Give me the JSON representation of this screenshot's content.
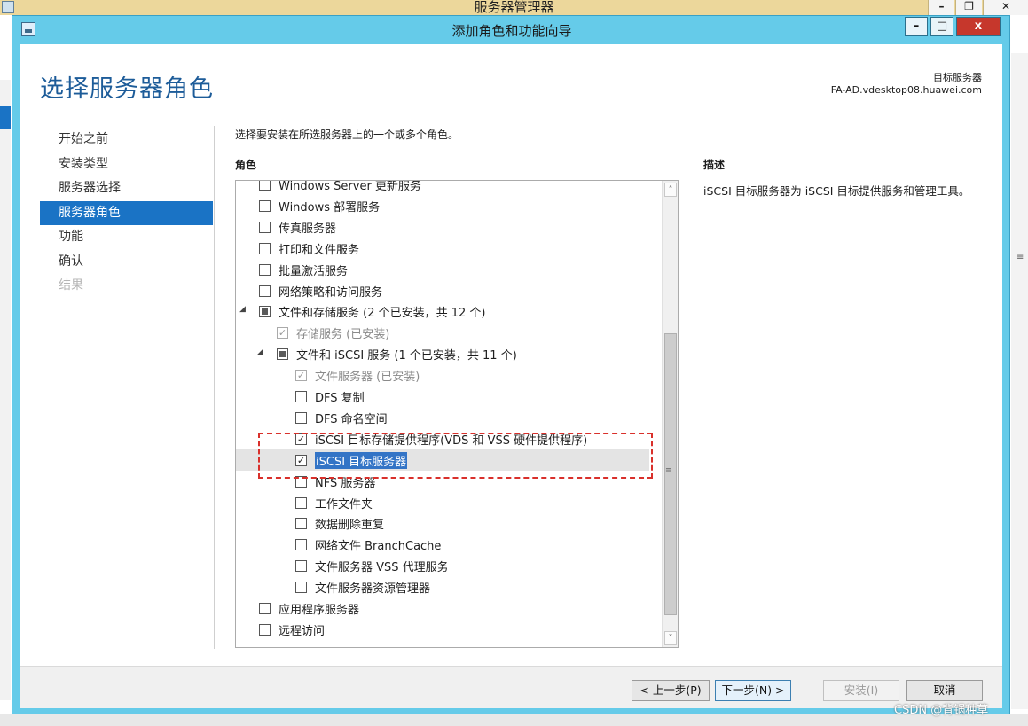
{
  "background_window": {
    "title": "服务器管理器",
    "buttons": [
      "–",
      "❐",
      "✕"
    ]
  },
  "wizard": {
    "title": "添加角色和功能向导",
    "controls": {
      "minimize": "–",
      "maximize": "□",
      "close": "x"
    },
    "heading": "选择服务器角色",
    "target_label": "目标服务器",
    "target_server": "FA-AD.vdesktop08.huawei.com"
  },
  "nav": {
    "items": [
      {
        "label": "开始之前",
        "state": "normal"
      },
      {
        "label": "安装类型",
        "state": "normal"
      },
      {
        "label": "服务器选择",
        "state": "normal"
      },
      {
        "label": "服务器角色",
        "state": "active"
      },
      {
        "label": "功能",
        "state": "normal"
      },
      {
        "label": "确认",
        "state": "normal"
      },
      {
        "label": "结果",
        "state": "disabled"
      }
    ]
  },
  "content": {
    "instruction": "选择要安装在所选服务器上的一个或多个角色。",
    "roles_label": "角色",
    "description_label": "描述",
    "description_text": "iSCSI 目标服务器为 iSCSI 目标提供服务和管理工具。"
  },
  "roles": [
    {
      "label": "Windows Server 更新服务",
      "level": 0,
      "check": "empty",
      "expander": "",
      "grey": false,
      "selected": false
    },
    {
      "label": "Windows 部署服务",
      "level": 0,
      "check": "empty",
      "expander": "",
      "grey": false,
      "selected": false
    },
    {
      "label": "传真服务器",
      "level": 0,
      "check": "empty",
      "expander": "",
      "grey": false,
      "selected": false
    },
    {
      "label": "打印和文件服务",
      "level": 0,
      "check": "empty",
      "expander": "",
      "grey": false,
      "selected": false
    },
    {
      "label": "批量激活服务",
      "level": 0,
      "check": "empty",
      "expander": "",
      "grey": false,
      "selected": false
    },
    {
      "label": "网络策略和访问服务",
      "level": 0,
      "check": "empty",
      "expander": "",
      "grey": false,
      "selected": false
    },
    {
      "label": "文件和存储服务 (2 个已安装，共 12 个)",
      "level": 0,
      "check": "partial",
      "expander": "◢",
      "grey": false,
      "selected": false
    },
    {
      "label": "存储服务 (已安装)",
      "level": 1,
      "check": "checked-disabled",
      "expander": "",
      "grey": true,
      "selected": false
    },
    {
      "label": "文件和 iSCSI 服务 (1 个已安装，共 11 个)",
      "level": 1,
      "check": "partial",
      "expander": "◢",
      "grey": false,
      "selected": false
    },
    {
      "label": "文件服务器 (已安装)",
      "level": 2,
      "check": "checked-disabled",
      "expander": "",
      "grey": true,
      "selected": false
    },
    {
      "label": "DFS 复制",
      "level": 2,
      "check": "empty",
      "expander": "",
      "grey": false,
      "selected": false
    },
    {
      "label": "DFS 命名空间",
      "level": 2,
      "check": "empty",
      "expander": "",
      "grey": false,
      "selected": false
    },
    {
      "label": "iSCSI 目标存储提供程序(VDS 和 VSS 硬件提供程序)",
      "level": 2,
      "check": "checked",
      "expander": "",
      "grey": false,
      "selected": false
    },
    {
      "label": "iSCSI 目标服务器",
      "level": 2,
      "check": "checked",
      "expander": "",
      "grey": false,
      "selected": true
    },
    {
      "label": "NFS 服务器",
      "level": 2,
      "check": "empty",
      "expander": "",
      "grey": false,
      "selected": false
    },
    {
      "label": "工作文件夹",
      "level": 2,
      "check": "empty",
      "expander": "",
      "grey": false,
      "selected": false
    },
    {
      "label": "数据删除重复",
      "level": 2,
      "check": "empty",
      "expander": "",
      "grey": false,
      "selected": false
    },
    {
      "label": "网络文件 BranchCache",
      "level": 2,
      "check": "empty",
      "expander": "",
      "grey": false,
      "selected": false
    },
    {
      "label": "文件服务器 VSS 代理服务",
      "level": 2,
      "check": "empty",
      "expander": "",
      "grey": false,
      "selected": false
    },
    {
      "label": "文件服务器资源管理器",
      "level": 2,
      "check": "empty",
      "expander": "",
      "grey": false,
      "selected": false
    },
    {
      "label": "应用程序服务器",
      "level": 0,
      "check": "empty",
      "expander": "",
      "grey": false,
      "selected": false
    },
    {
      "label": "远程访问",
      "level": 0,
      "check": "empty",
      "expander": "",
      "grey": false,
      "selected": false
    }
  ],
  "scrollbar": {
    "up": "˄",
    "down": "˅",
    "grip": "≡"
  },
  "footer": {
    "prev": "< 上一步(P)",
    "next": "下一步(N) >",
    "install": "安装(I)",
    "cancel": "取消"
  },
  "watermark": "CSDN @背锅种草"
}
